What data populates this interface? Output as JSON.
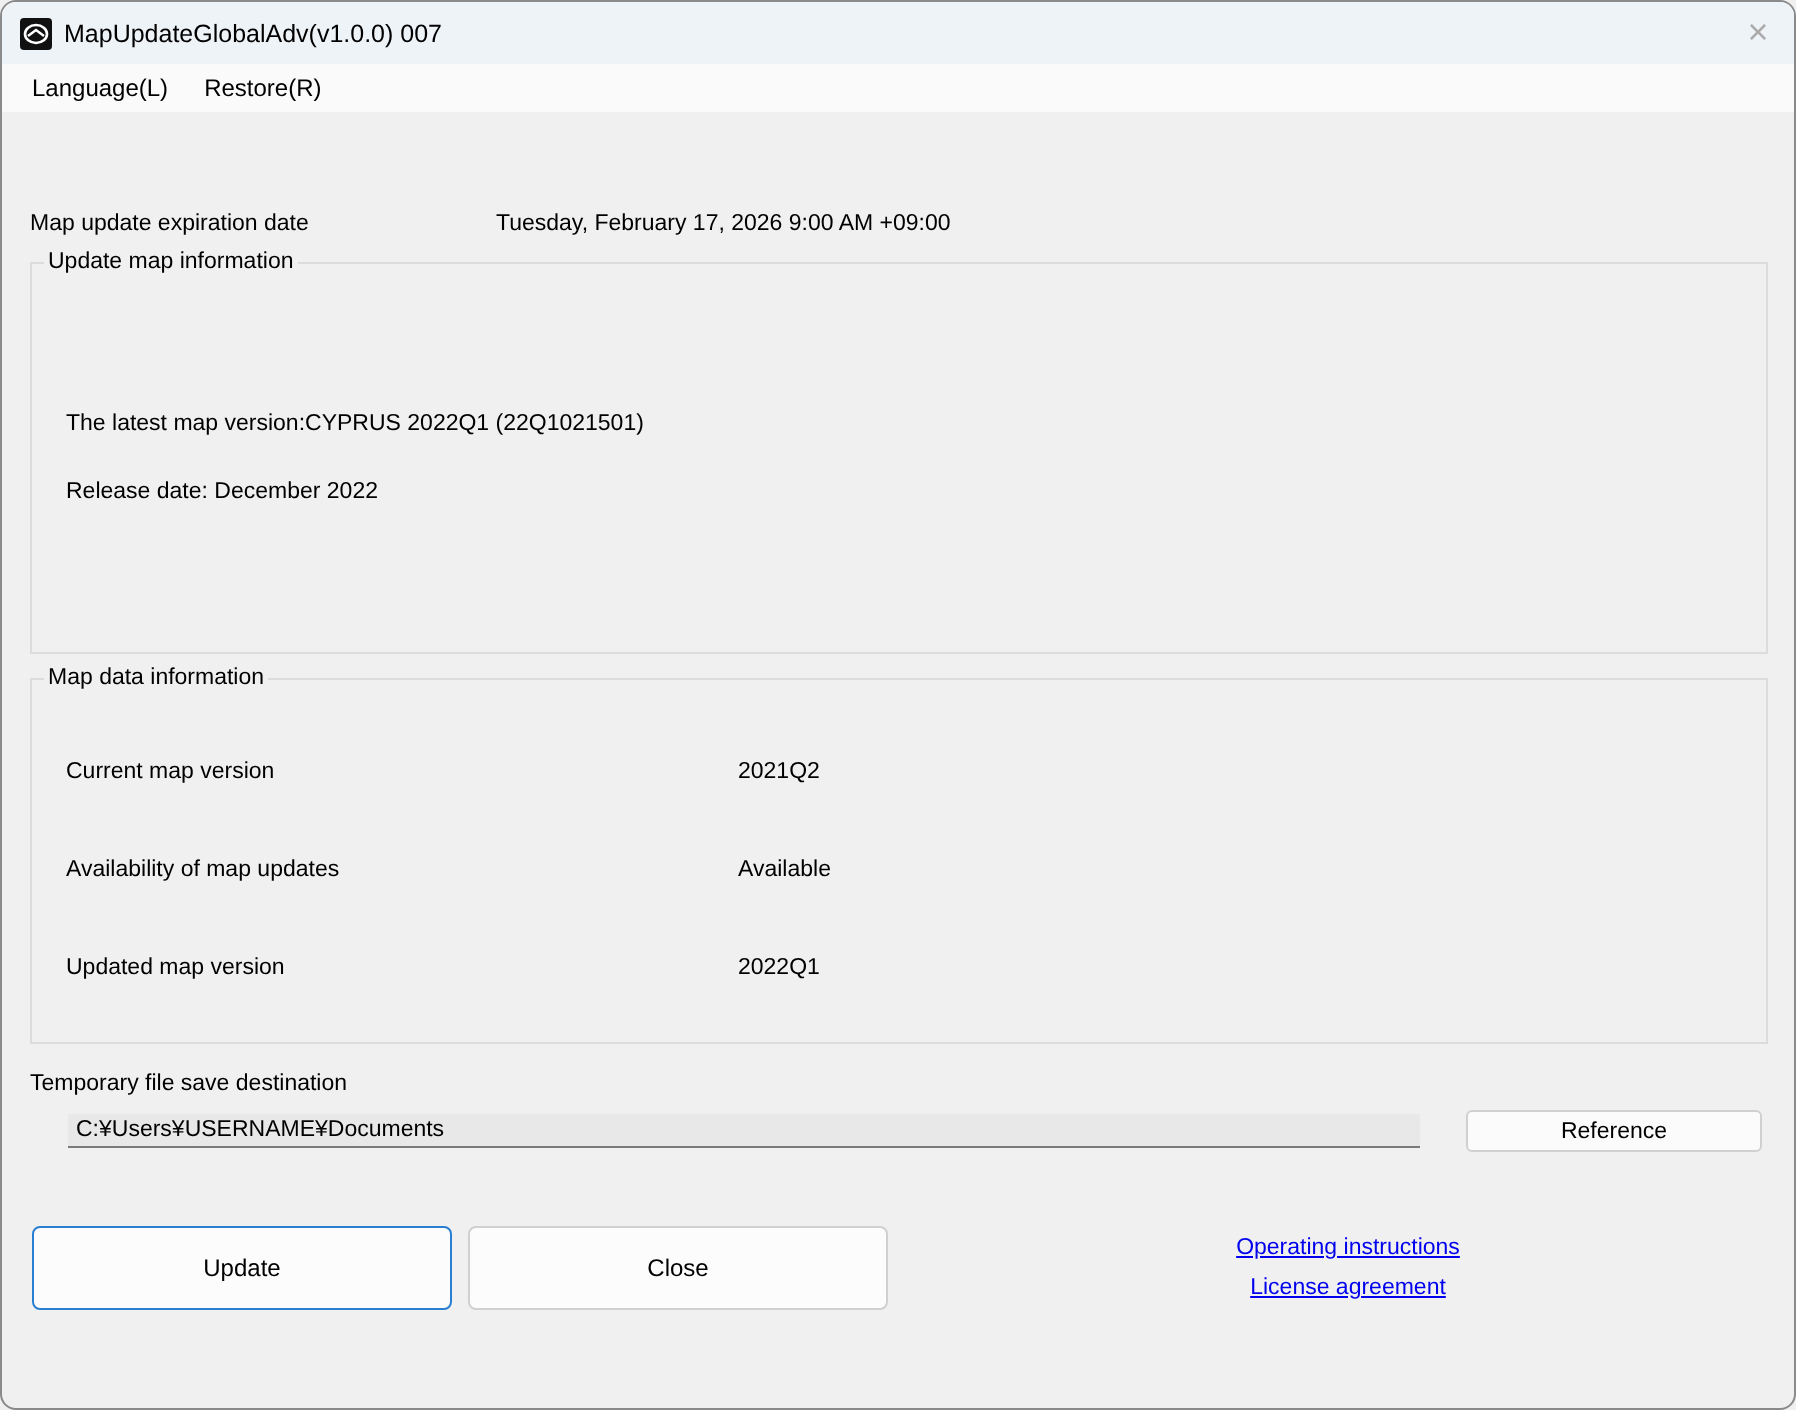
{
  "window": {
    "title": "MapUpdateGlobalAdv(v1.0.0) 007",
    "close": "×"
  },
  "menu": [
    "Language(L)",
    "Restore(R)"
  ],
  "expiration": {
    "label": "Map update expiration date",
    "value": "Tuesday, February 17, 2026 9:00 AM  +09:00"
  },
  "update_map_information": {
    "title": "Update map information",
    "lines": [
      "The latest map version:CYPRUS 2022Q1 (22Q1021501)",
      "Release date: December 2022"
    ]
  },
  "map_data_information": {
    "title": "Map data information",
    "rows": [
      {
        "label": "Current map version",
        "value": "2021Q2"
      },
      {
        "label": "Availability of map updates",
        "value": "Available"
      },
      {
        "label": "Updated map version",
        "value": "2022Q1"
      }
    ]
  },
  "save_destination": {
    "label": "Temporary file save destination",
    "value": "C:¥Users¥USERNAME¥Documents",
    "button": "Reference"
  },
  "buttons": [
    {
      "label": "Update",
      "focused": true
    },
    {
      "label": "Close",
      "focused": false
    }
  ],
  "links": [
    "Operating instructions",
    "License agreement"
  ]
}
